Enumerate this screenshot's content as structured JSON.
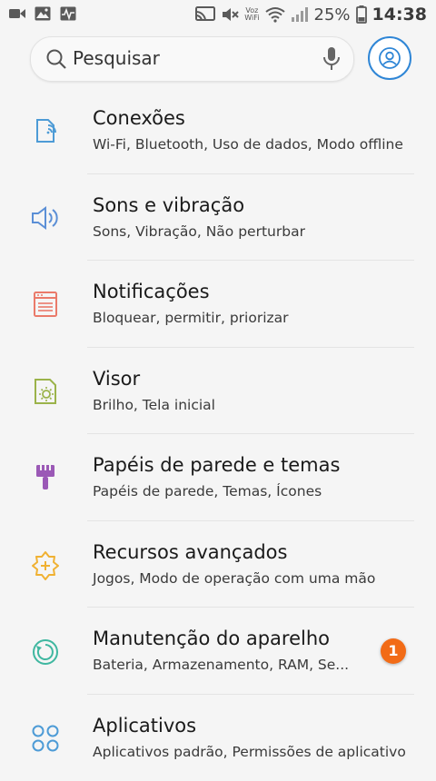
{
  "status_bar": {
    "left_icons": [
      "video-camera-icon",
      "image-icon",
      "activity-icon"
    ],
    "right_icons": [
      "cast-icon",
      "mute-icon",
      "volte-icon",
      "wifi-icon",
      "signal-icon",
      "battery-icon"
    ],
    "volte_line1": "Voz",
    "volte_line2": "WiFi",
    "battery": "25%",
    "time": "14:38"
  },
  "search": {
    "placeholder": "Pesquisar",
    "icons": [
      "search-icon",
      "mic-icon",
      "profile-icon"
    ]
  },
  "colors": {
    "accent": "#2f86d6",
    "badge": "#f26b16",
    "connections_icon": "#4d9bd6",
    "sounds_icon": "#5b8fd6",
    "notifications_icon": "#ea7a6a",
    "display_icon": "#9bb34a",
    "themes_icon": "#9b59b6",
    "advanced_icon": "#f0b132",
    "maintenance_icon": "#3fb7a0",
    "apps_icon": "#4d9bd6"
  },
  "settings": [
    {
      "title": "Conexões",
      "subtitle": "Wi-Fi, Bluetooth, Uso de dados, Modo offline",
      "icon": "connections-icon"
    },
    {
      "title": "Sons e vibração",
      "subtitle": "Sons, Vibração, Não perturbar",
      "icon": "sound-icon"
    },
    {
      "title": "Notificações",
      "subtitle": "Bloquear, permitir, priorizar",
      "icon": "notifications-icon"
    },
    {
      "title": "Visor",
      "subtitle": "Brilho, Tela inicial",
      "icon": "display-icon"
    },
    {
      "title": "Papéis de parede e temas",
      "subtitle": "Papéis de parede, Temas, Ícones",
      "icon": "brush-icon"
    },
    {
      "title": "Recursos avançados",
      "subtitle": "Jogos, Modo de operação com uma mão",
      "icon": "advanced-features-icon"
    },
    {
      "title": "Manutenção do aparelho",
      "subtitle": "Bateria, Armazenamento, RAM, Se...",
      "icon": "maintenance-icon",
      "badge": "1"
    },
    {
      "title": "Aplicativos",
      "subtitle": "Aplicativos padrão, Permissões de aplicativo",
      "icon": "apps-icon"
    }
  ]
}
